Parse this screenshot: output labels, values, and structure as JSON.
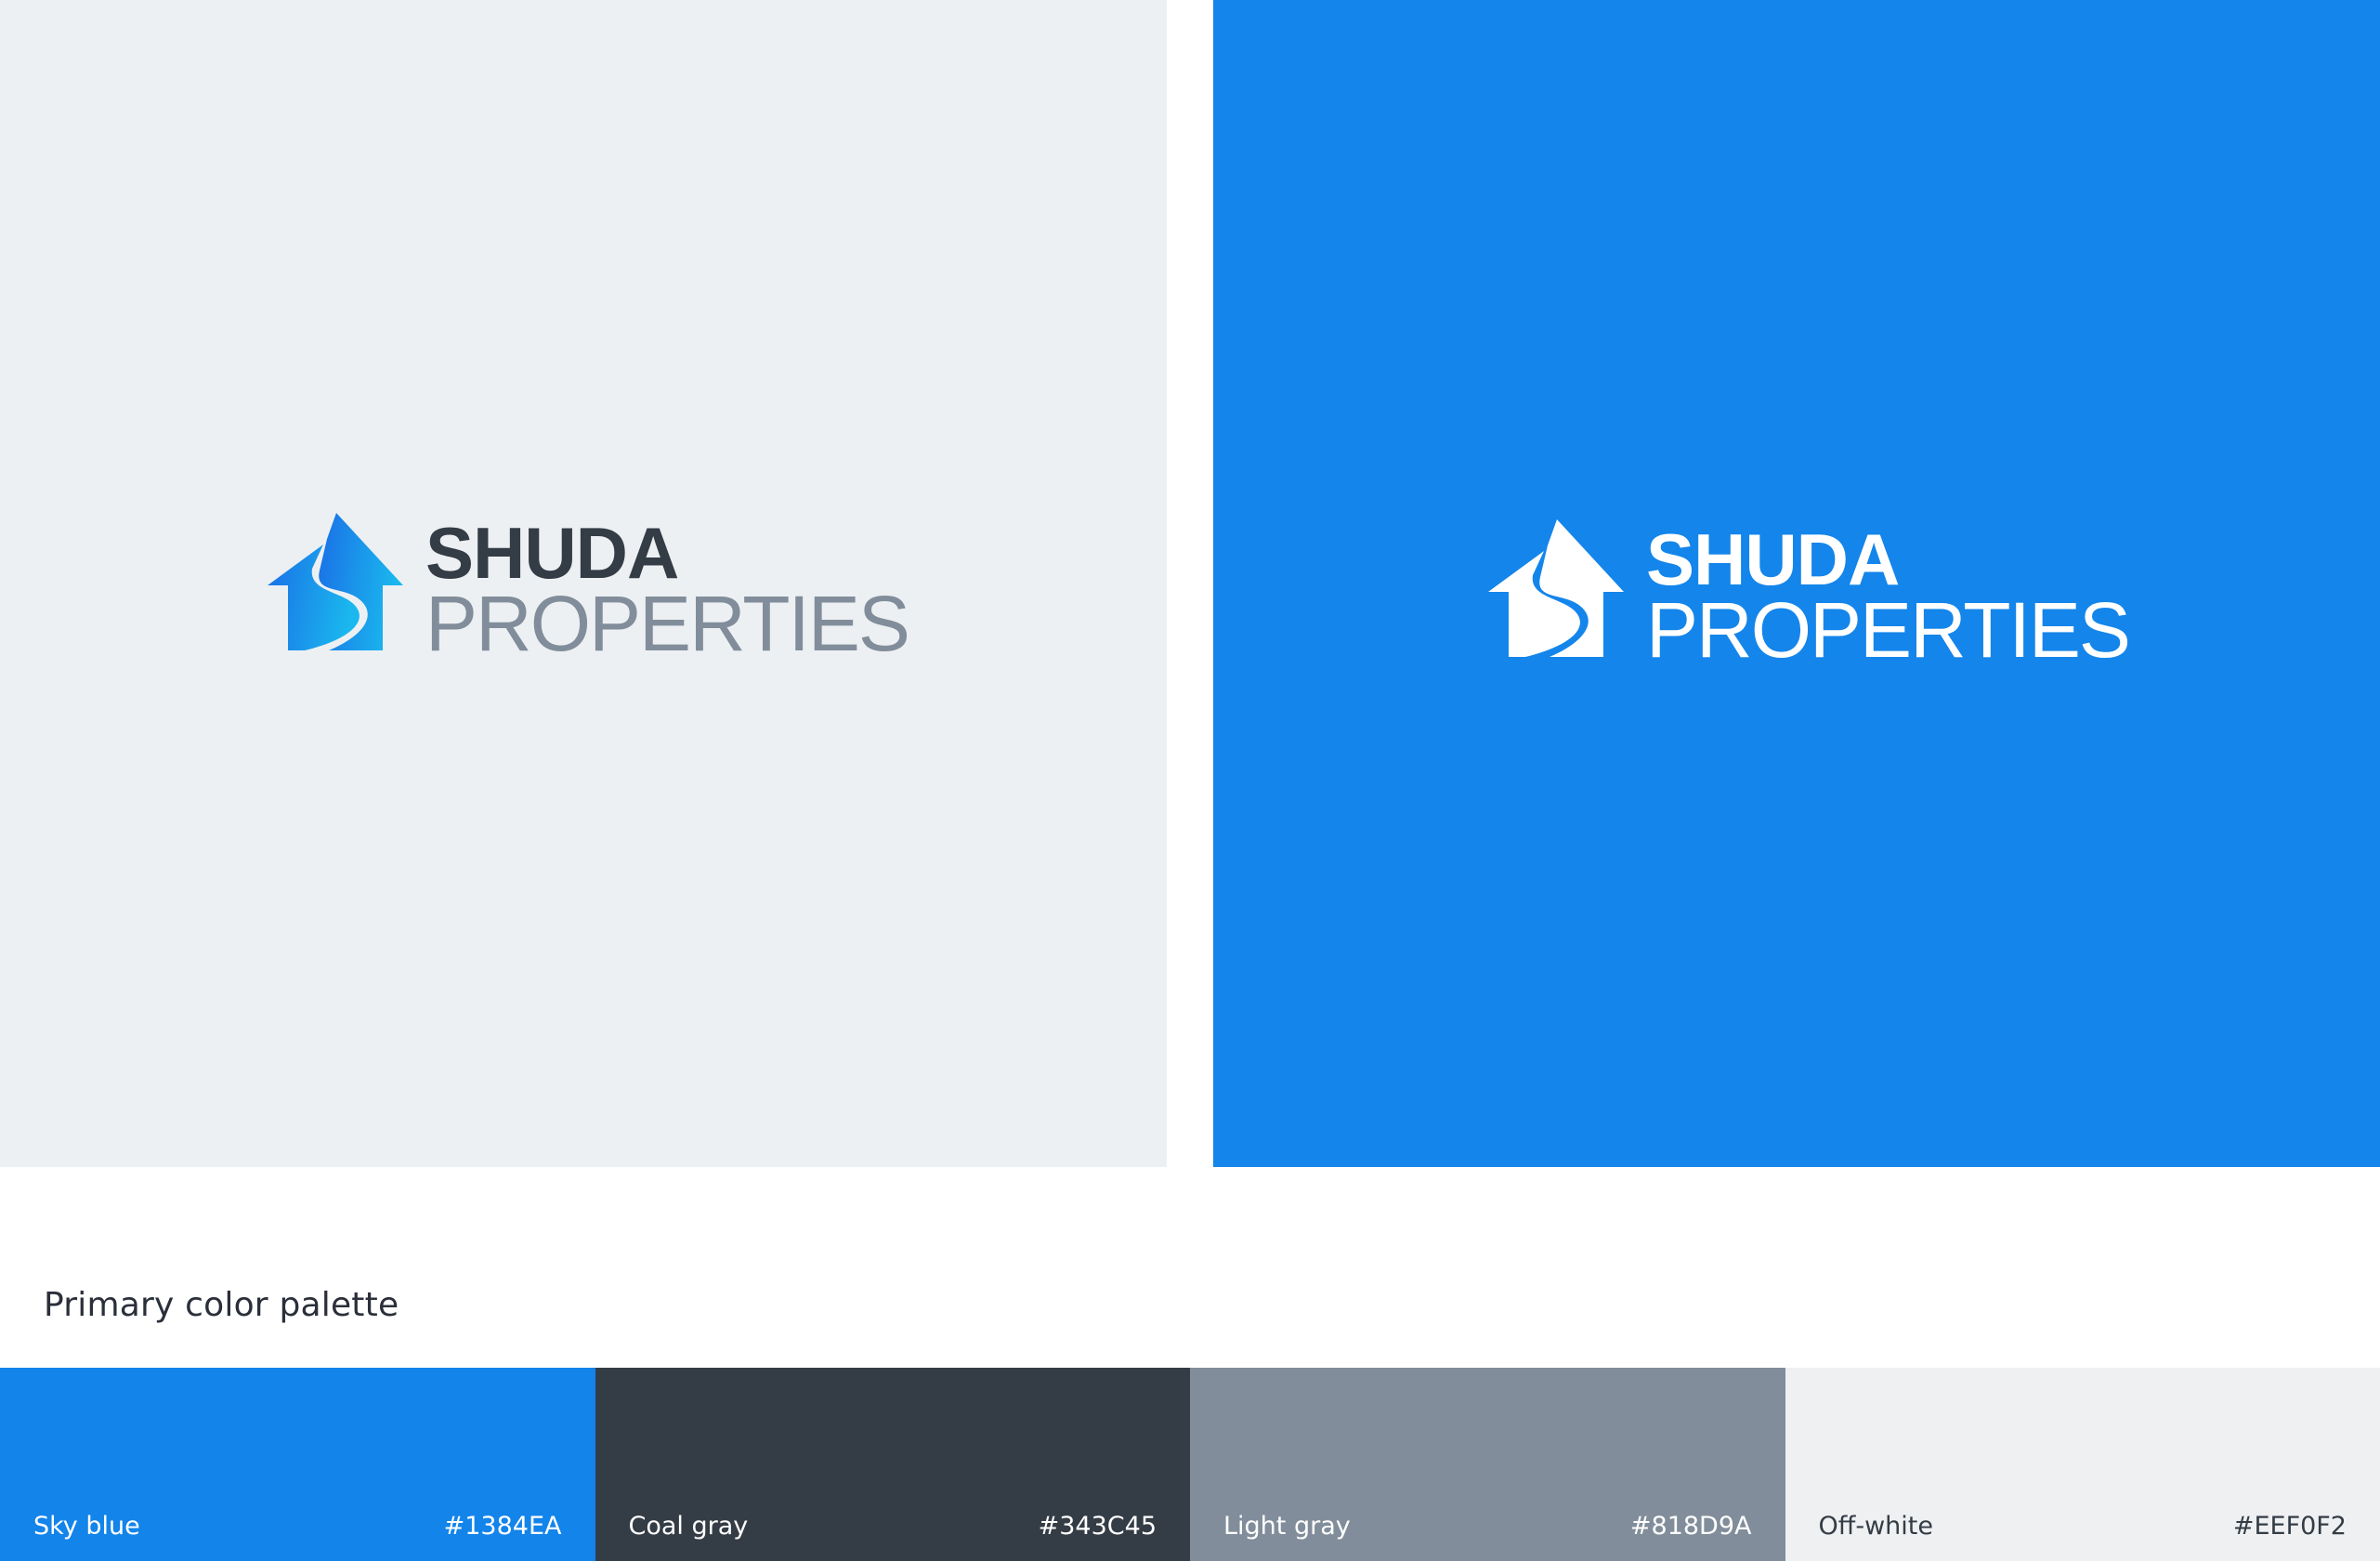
{
  "logo": {
    "line1": "SHUDA",
    "line2": "PROPERTIES",
    "icon": "house-arrow-s-icon"
  },
  "colors": {
    "light_panel_bg": "#EDF0F3",
    "blue_panel_bg": "#1485EA",
    "wordmark_dark": "#343C45",
    "wordmark_gray": "#818D9A",
    "wordmark_white": "#FFFFFF",
    "mark_gradient_start": "#1A6FE6",
    "mark_gradient_end": "#1AB8EE"
  },
  "palette": {
    "title": "Primary color palette",
    "swatches": [
      {
        "name": "Sky blue",
        "hex": "#1384EA",
        "color": "#1384EA",
        "text_color": "#FFFFFF"
      },
      {
        "name": "Coal gray",
        "hex": "#343C45",
        "color": "#343C45",
        "text_color": "#FFFFFF"
      },
      {
        "name": "Light gray",
        "hex": "#818D9A",
        "color": "#818D9A",
        "text_color": "#FFFFFF"
      },
      {
        "name": "Off-white",
        "hex": "#EEF0F2",
        "color": "#EEF0F2",
        "text_color": "#343C45"
      }
    ]
  }
}
